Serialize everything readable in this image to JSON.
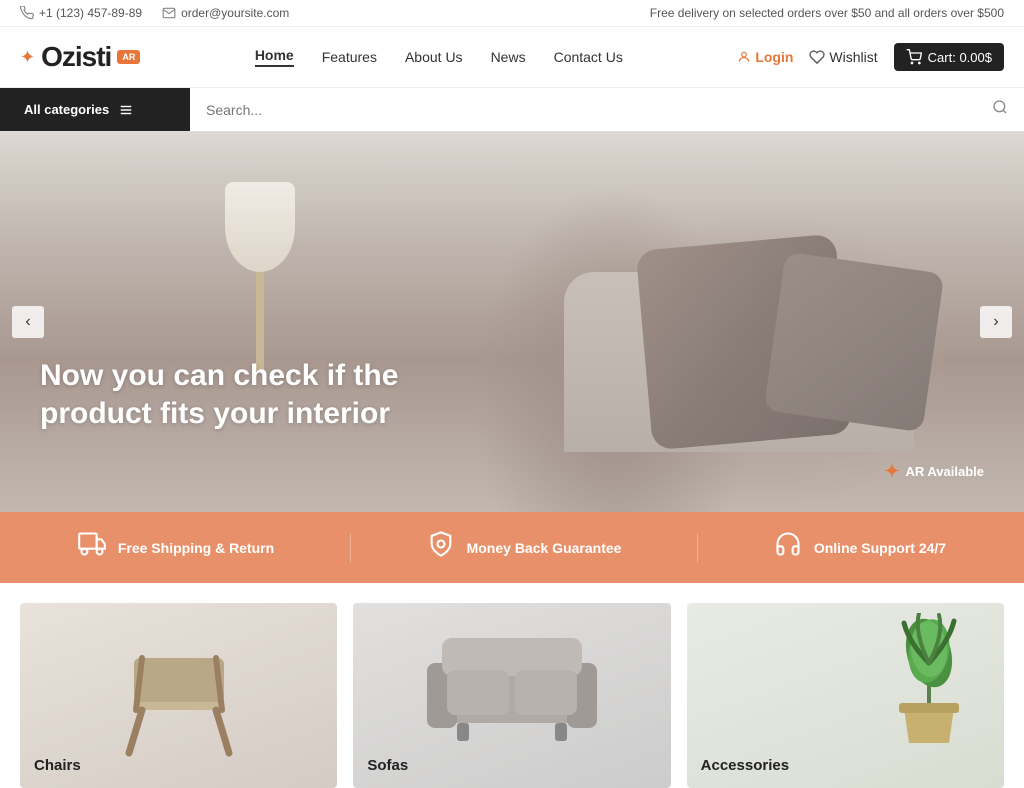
{
  "topbar": {
    "phone": "+1 (123) 457-89-89",
    "email": "order@yoursite.com",
    "promo": "Free delivery on selected orders over $50 and all orders over $500"
  },
  "header": {
    "logo_text": "Ozisti",
    "logo_ar": "AR",
    "nav": {
      "home": "Home",
      "features": "Features",
      "about": "About Us",
      "news": "News",
      "contact": "Contact Us",
      "login": "Login",
      "wishlist": "Wishlist",
      "cart": "Cart: 0.00$"
    }
  },
  "search": {
    "categories_label": "All categories",
    "placeholder": "Search..."
  },
  "hero": {
    "headline": "Now you can check if the product fits your interior",
    "ar_label": "AR Available",
    "prev_label": "‹",
    "next_label": "›"
  },
  "features": {
    "items": [
      {
        "icon": "🚚",
        "label": "Free Shipping & Return"
      },
      {
        "icon": "🛡",
        "label": "Money Back Guarantee"
      },
      {
        "icon": "📞",
        "label": "Online Support 24/7"
      }
    ]
  },
  "products": {
    "items": [
      {
        "label": "Chairs",
        "bg": "chair"
      },
      {
        "label": "Sofas",
        "bg": "sofa"
      },
      {
        "label": "Accessories",
        "bg": "plants"
      }
    ]
  }
}
